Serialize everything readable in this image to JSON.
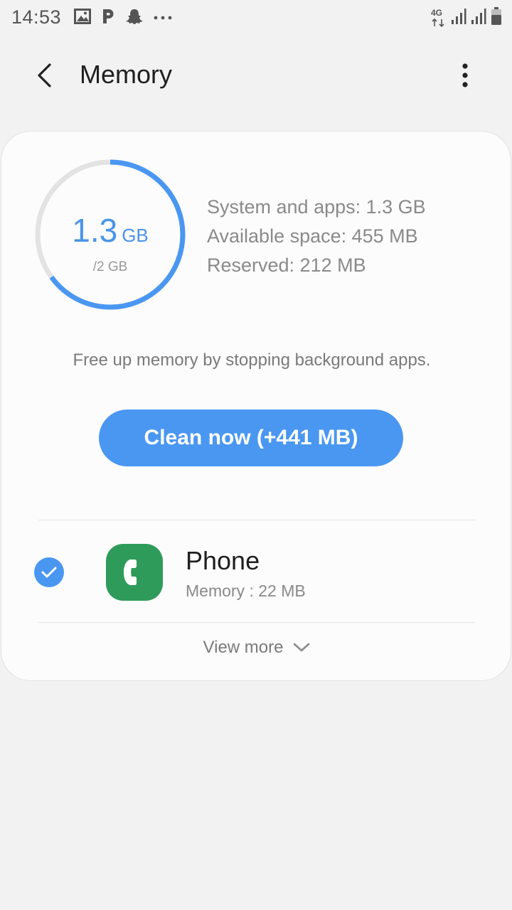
{
  "status_bar": {
    "time": "14:53",
    "network_type": "4G",
    "icons_left": [
      "gallery-icon",
      "pinterest-icon",
      "snapchat-icon",
      "more-notifications-icon"
    ],
    "icons_right": [
      "network-4g-icon",
      "signal-icon",
      "signal-icon",
      "battery-icon"
    ]
  },
  "app_bar": {
    "title": "Memory",
    "back_icon": "chevron-left-icon",
    "menu_icon": "more-vertical-icon"
  },
  "memory": {
    "used_value": "1.3",
    "used_unit": "GB",
    "total": "/2 GB",
    "used_fraction": 0.65,
    "accent_color": "#4a97f2",
    "track_color": "#e3e3e3",
    "stats": {
      "system_and_apps": "System and apps: 1.3 GB",
      "available": "Available space: 455 MB",
      "reserved": "Reserved: 212 MB"
    },
    "hint": "Free up memory by stopping background apps.",
    "clean_label": "Clean now (+441 MB)"
  },
  "apps": [
    {
      "name": "Phone",
      "memory": "Memory : 22 MB",
      "checked": true,
      "icon": "phone-app-icon",
      "icon_color": "#2f9b5b"
    }
  ],
  "view_more_label": "View more"
}
